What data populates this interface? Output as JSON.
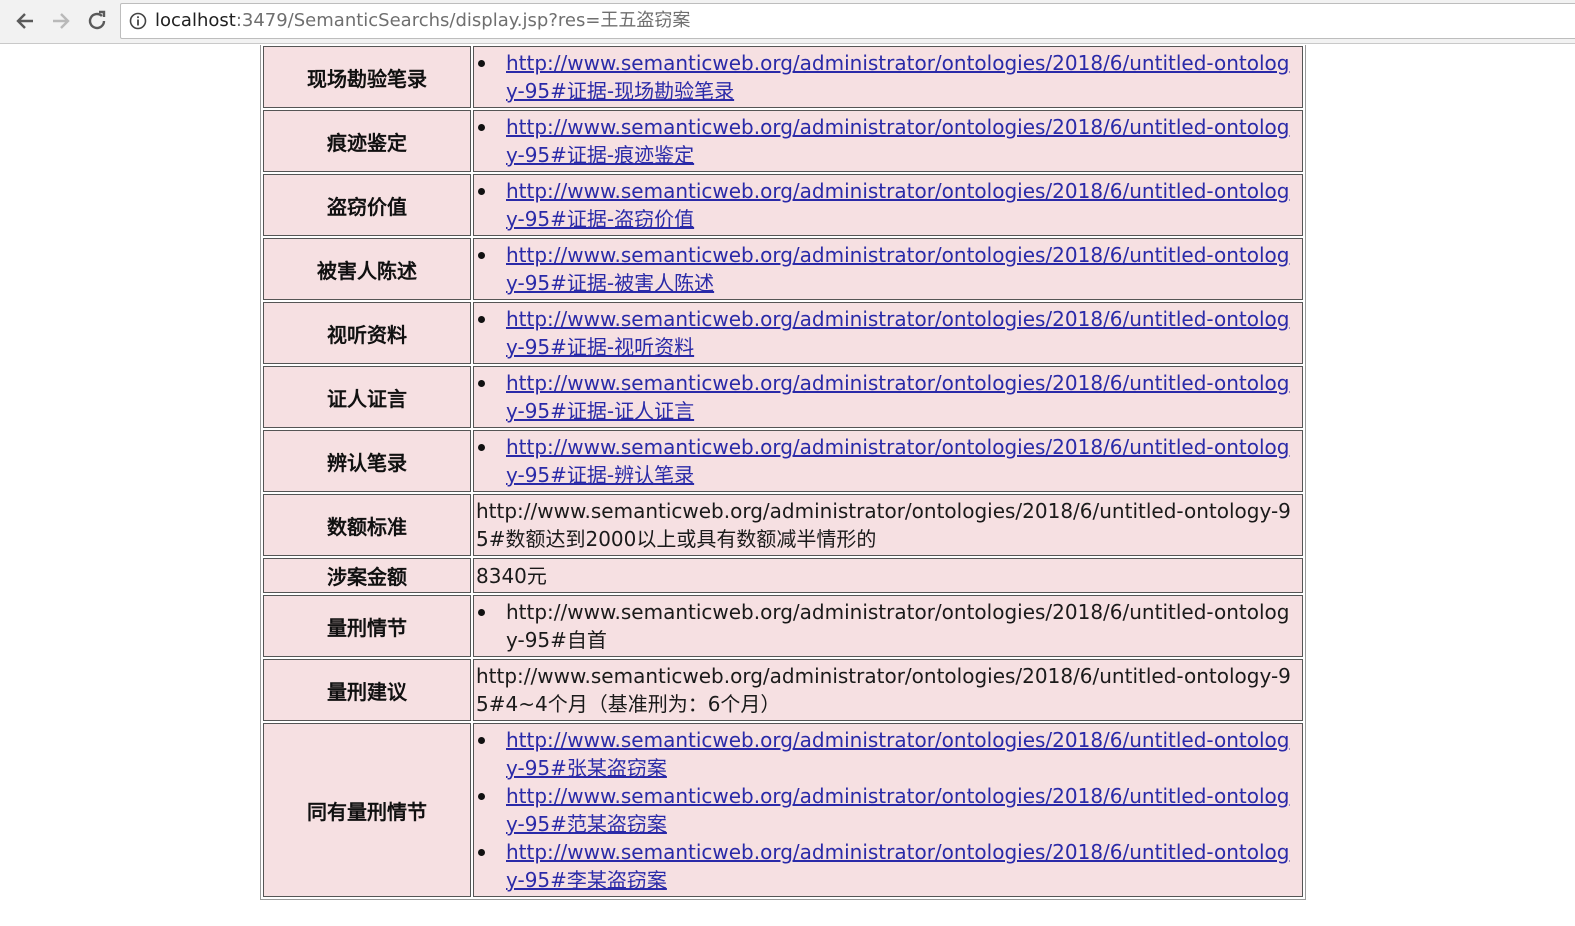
{
  "browser": {
    "url_host": "localhost",
    "url_rest": ":3479/SemanticSearchs/display.jsp?res=王五盗窃案"
  },
  "rows": [
    {
      "label": "现场勘验笔录",
      "links": [
        "http://www.semanticweb.org/administrator/ontologies/2018/6/untitled-ontology-95#证据-现场勘验笔录"
      ]
    },
    {
      "label": "痕迹鉴定",
      "links": [
        "http://www.semanticweb.org/administrator/ontologies/2018/6/untitled-ontology-95#证据-痕迹鉴定"
      ]
    },
    {
      "label": "盗窃价值",
      "links": [
        "http://www.semanticweb.org/administrator/ontologies/2018/6/untitled-ontology-95#证据-盗窃价值"
      ]
    },
    {
      "label": "被害人陈述",
      "links": [
        "http://www.semanticweb.org/administrator/ontologies/2018/6/untitled-ontology-95#证据-被害人陈述"
      ]
    },
    {
      "label": "视听资料",
      "links": [
        "http://www.semanticweb.org/administrator/ontologies/2018/6/untitled-ontology-95#证据-视听资料"
      ]
    },
    {
      "label": "证人证言",
      "links": [
        "http://www.semanticweb.org/administrator/ontologies/2018/6/untitled-ontology-95#证据-证人证言"
      ]
    },
    {
      "label": "辨认笔录",
      "links": [
        "http://www.semanticweb.org/administrator/ontologies/2018/6/untitled-ontology-95#证据-辨认笔录"
      ]
    },
    {
      "label": "数额标准",
      "text": "http://www.semanticweb.org/administrator/ontologies/2018/6/untitled-ontology-95#数额达到2000以上或具有数额减半情形的"
    },
    {
      "label": "涉案金额",
      "text": "8340元"
    },
    {
      "label": "量刑情节",
      "items": [
        "http://www.semanticweb.org/administrator/ontologies/2018/6/untitled-ontology-95#自首"
      ]
    },
    {
      "label": "量刑建议",
      "text": "http://www.semanticweb.org/administrator/ontologies/2018/6/untitled-ontology-95#4~4个月（基准刑为：6个月）"
    },
    {
      "label": "同有量刑情节",
      "links": [
        "http://www.semanticweb.org/administrator/ontologies/2018/6/untitled-ontology-95#张某盗窃案",
        "http://www.semanticweb.org/administrator/ontologies/2018/6/untitled-ontology-95#范某盗窃案",
        "http://www.semanticweb.org/administrator/ontologies/2018/6/untitled-ontology-95#李某盗窃案"
      ]
    }
  ]
}
